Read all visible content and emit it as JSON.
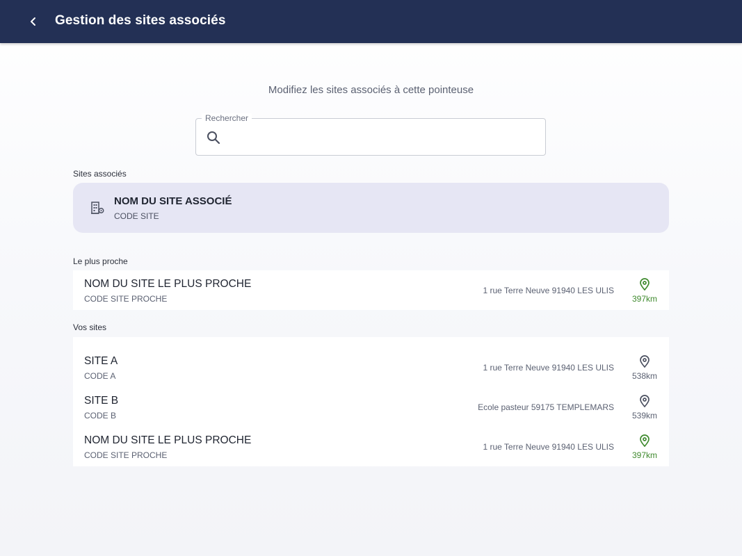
{
  "header": {
    "title": "Gestion des sites associés"
  },
  "subtitle": "Modifiez les sites associés à cette pointeuse",
  "search": {
    "label": "Rechercher",
    "value": "",
    "placeholder": ""
  },
  "associated": {
    "section_label": "Sites associés",
    "name": "NOM DU SITE ASSOCIÉ",
    "code": "CODE SITE"
  },
  "nearest": {
    "section_label": "Le plus proche",
    "items": [
      {
        "name": "NOM DU SITE LE PLUS PROCHE",
        "code": "CODE SITE PROCHE",
        "address": "1 rue Terre Neuve 91940 LES ULIS",
        "distance": "397km",
        "highlight": true
      }
    ]
  },
  "your_sites": {
    "section_label": "Vos sites",
    "items": [
      {
        "name": "SITE A",
        "code": "CODE A",
        "address": "1 rue Terre Neuve 91940 LES ULIS",
        "distance": "538km",
        "highlight": false
      },
      {
        "name": "SITE B",
        "code": "CODE B",
        "address": "Ecole pasteur 59175 TEMPLEMARS",
        "distance": "539km",
        "highlight": false
      },
      {
        "name": "NOM DU SITE LE PLUS PROCHE",
        "code": "CODE SITE PROCHE",
        "address": "1 rue Terre Neuve 91940 LES ULIS",
        "distance": "397km",
        "highlight": true
      }
    ]
  },
  "colors": {
    "header_bg": "#233055",
    "highlight_green": "#3f8a2e",
    "neutral_gray": "#5b6172",
    "associated_card_bg": "#e6e6f4"
  },
  "icons": {
    "back": "chevron-left-icon",
    "search": "search-icon",
    "building": "building-location-icon",
    "pin": "map-pin-icon"
  }
}
